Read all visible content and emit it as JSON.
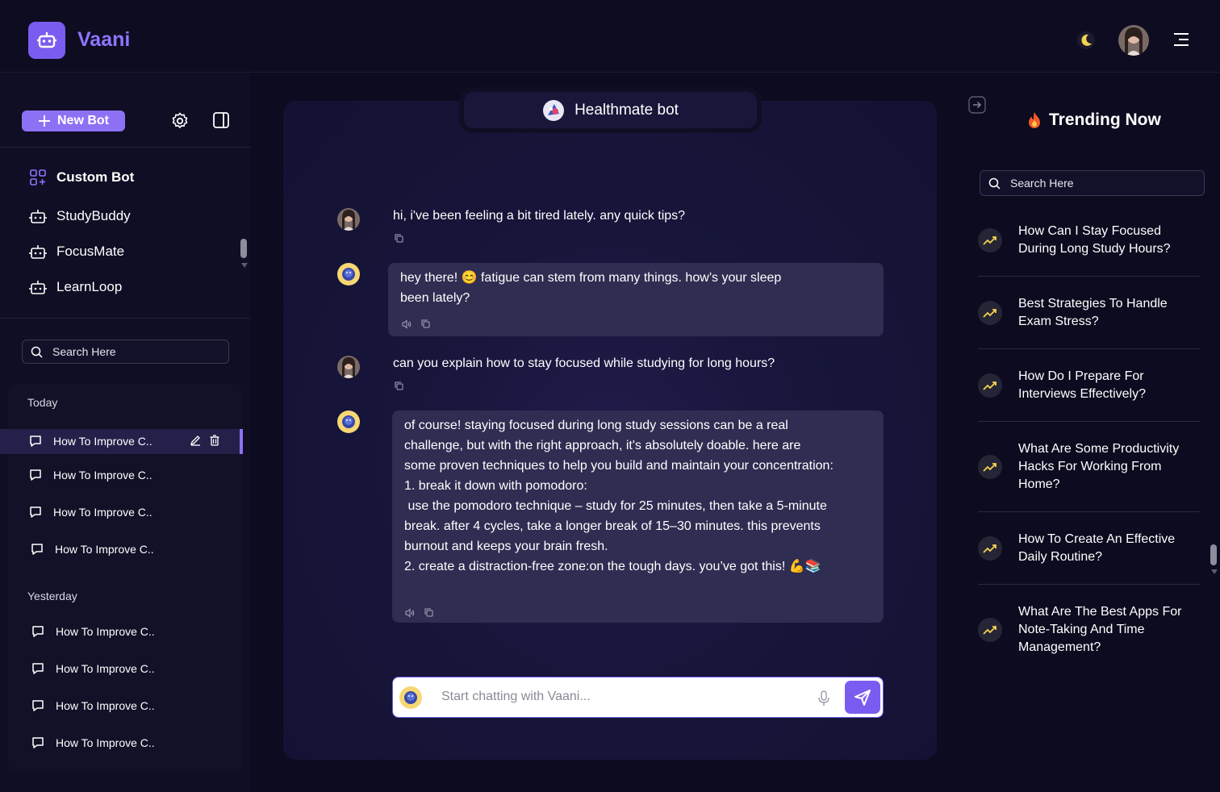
{
  "app": {
    "name": "Vaani",
    "logo_icon": "robot-icon"
  },
  "header": {
    "theme_icon": "moon-icon",
    "menu_icon": "menu-icon"
  },
  "sidebar": {
    "new_bot_label": "New Bot",
    "bots": [
      {
        "label": "Custom Bot",
        "icon": "grid-icon"
      },
      {
        "label": "StudyBuddy",
        "icon": "robot-icon"
      },
      {
        "label": "FocusMate",
        "icon": "robot-icon"
      },
      {
        "label": "LearnLoop",
        "icon": "robot-icon"
      }
    ],
    "search_placeholder": "Search Here",
    "groups": [
      {
        "title": "Today",
        "items": [
          "How To Improve C..",
          "How To Improve C..",
          "How To Improve C..",
          "How To Improve C.."
        ]
      },
      {
        "title": "Yesterday",
        "items": [
          "How To Improve C..",
          "How To Improve C..",
          "How To Improve C..",
          "How To Improve C.."
        ]
      }
    ]
  },
  "chat": {
    "bot_name": "Healthmate bot",
    "messages": [
      {
        "role": "user",
        "text": "hi, i've been feeling a bit tired lately. any quick tips?"
      },
      {
        "role": "bot",
        "lines": [
          "hey there! 😊 fatigue can stem from many things. how’s your sleep",
          "been lately?"
        ]
      },
      {
        "role": "user",
        "text": "can you explain how to stay focused while studying for long hours?"
      },
      {
        "role": "bot",
        "lines": [
          "of course! staying focused during long study sessions can be a real",
          "challenge, but with the right approach, it's absolutely doable. here are",
          "some proven techniques to help you build and maintain your concentration:",
          "1. break it down with pomodoro:",
          " use the pomodoro technique – study for 25 minutes, then take a 5-minute",
          "break. after 4 cycles, take a longer break of 15–30 minutes. this prevents",
          "burnout and keeps your brain fresh.",
          "2. create a distraction-free zone:on the tough days. you’ve got this! 💪📚"
        ]
      }
    ],
    "input_placeholder": "Start chatting with Vaani..."
  },
  "trending": {
    "title": "Trending Now",
    "search_placeholder": "Search Here",
    "items": [
      "How Can I Stay Focused During Long Study Hours?",
      "Best Strategies To Handle Exam Stress?",
      "How Do I Prepare For Interviews Effectively?",
      "What Are Some Productivity Hacks For Working From Home?",
      "How To Create An Effective Daily Routine?",
      "What Are The Best Apps For Note-Taking And Time Management?"
    ]
  },
  "colors": {
    "accent": "#7b5cf0",
    "background": "#0c0b1f",
    "bubble": "#302d52"
  }
}
